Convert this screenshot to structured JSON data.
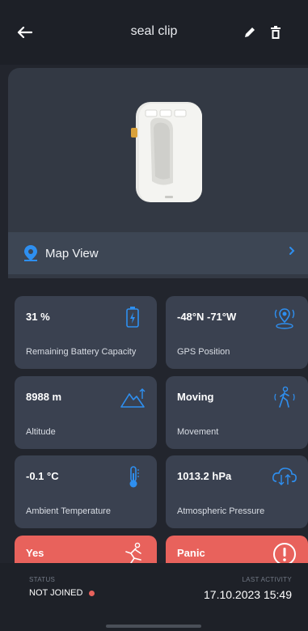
{
  "header": {
    "title": "seal clip"
  },
  "map_view": {
    "label": "Map View"
  },
  "tiles": [
    {
      "value": "31 %",
      "label": "Remaining Battery Capacity",
      "icon": "battery-icon"
    },
    {
      "value": "-48°N -71°W",
      "label": "GPS Position",
      "icon": "gps-pin-icon"
    },
    {
      "value": "8988 m",
      "label": "Altitude",
      "icon": "mountain-icon"
    },
    {
      "value": "Moving",
      "label": "Movement",
      "icon": "walking-person-icon"
    },
    {
      "value": "-0.1 °C",
      "label": "Ambient Temperature",
      "icon": "thermometer-icon"
    },
    {
      "value": "1013.2 hPa",
      "label": "Atmospheric Pressure",
      "icon": "pressure-cloud-icon"
    },
    {
      "value": "Yes",
      "label": "",
      "icon": "fall-person-icon"
    },
    {
      "value": "Panic",
      "label": "",
      "icon": "alert-circle-icon"
    }
  ],
  "footer": {
    "status_caption": "STATUS",
    "status_value": "NOT JOINED",
    "activity_caption": "LAST ACTIVITY",
    "activity_value": "17.10.2023 15:49"
  },
  "colors": {
    "accent": "#2e8ff0",
    "alert": "#e8625c",
    "tile": "#3a4150",
    "background": "#22252d"
  }
}
